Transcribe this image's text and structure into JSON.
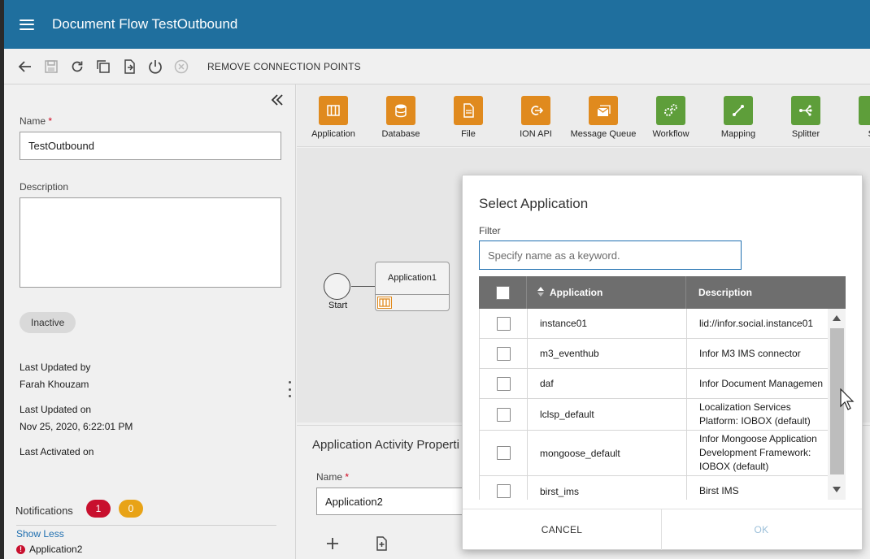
{
  "app": {
    "title": "Document Flow TestOutbound"
  },
  "toolbar": {
    "icons": [
      "back-icon",
      "save-icon",
      "refresh-icon",
      "copy-icon",
      "export-icon",
      "power-icon",
      "cancel-icon"
    ],
    "remove_label": "REMOVE CONNECTION POINTS"
  },
  "left": {
    "name_label": "Name",
    "required_mark": "*",
    "name_value": "TestOutbound",
    "description_label": "Description",
    "description_value": "",
    "status": "Inactive",
    "last_updated_by_label": "Last Updated by",
    "last_updated_by": "Farah Khouzam",
    "last_updated_on_label": "Last Updated on",
    "last_updated_on": "Nov 25, 2020, 6:22:01 PM",
    "last_activated_label": "Last Activated on",
    "notifications_label": "Notifications",
    "notif_errors": "1",
    "notif_warnings": "0",
    "show_less": "Show Less",
    "error_item": "Application2",
    "error_mark": "!"
  },
  "palette": [
    {
      "label": "Application",
      "icon": "application-icon",
      "color": "#e08a1e"
    },
    {
      "label": "Database",
      "icon": "database-icon",
      "color": "#e08a1e"
    },
    {
      "label": "File",
      "icon": "file-icon",
      "color": "#e08a1e"
    },
    {
      "label": "ION API",
      "icon": "ion-api-icon",
      "color": "#e08a1e"
    },
    {
      "label": "Message Queue",
      "icon": "message-queue-icon",
      "color": "#e08a1e"
    },
    {
      "label": "Workflow",
      "icon": "workflow-icon",
      "color": "#5e9e3a"
    },
    {
      "label": "Mapping",
      "icon": "mapping-icon",
      "color": "#5e9e3a"
    },
    {
      "label": "Splitter",
      "icon": "splitter-icon",
      "color": "#5e9e3a"
    },
    {
      "label": "Sc",
      "icon": "scripting-icon",
      "color": "#5e9e3a"
    }
  ],
  "canvas": {
    "start_label": "Start",
    "node_label": "Application1"
  },
  "properties": {
    "title": "Application Activity Properti",
    "name_label": "Name",
    "name_value": "Application2"
  },
  "dialog": {
    "title": "Select Application",
    "filter_label": "Filter",
    "filter_placeholder": "Specify name as a keyword.",
    "col_application": "Application",
    "col_description": "Description",
    "rows": [
      {
        "name": "instance01",
        "desc": "lid://infor.social.instance01"
      },
      {
        "name": "m3_eventhub",
        "desc": "Infor M3 IMS connector"
      },
      {
        "name": "daf",
        "desc": "Infor Document Managemen"
      },
      {
        "name": "lclsp_default",
        "desc": "Localization Services Platform: IOBOX (default)"
      },
      {
        "name": "mongoose_default",
        "desc": "Infor Mongoose Application Development Framework: IOBOX (default)"
      },
      {
        "name": "birst_ims",
        "desc": "Birst IMS"
      }
    ],
    "cancel_label": "CANCEL",
    "ok_label": "OK"
  },
  "colors": {
    "header": "#1f6f9e",
    "accent_orange": "#e08a1e",
    "accent_green": "#5e9e3a",
    "error_badge": "#c8102e",
    "warning_badge": "#e8a317",
    "link": "#1f6fb0",
    "ok_disabled": "#9bbfd9"
  }
}
